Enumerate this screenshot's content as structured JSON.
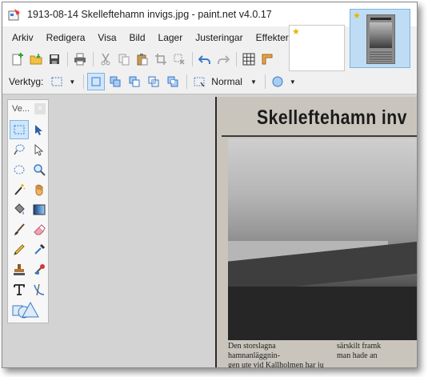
{
  "window": {
    "title": "1913-08-14 Skelleftehamn invigs.jpg - paint.net v4.0.17"
  },
  "menu": [
    "Arkiv",
    "Redigera",
    "Visa",
    "Bild",
    "Lager",
    "Justeringar",
    "Effekter"
  ],
  "toolbar": {
    "buttons": [
      "new-icon",
      "open-icon",
      "save-icon",
      "print-icon",
      "cut-icon",
      "copy-icon",
      "paste-icon",
      "crop-icon",
      "deselect-icon",
      "undo-icon",
      "redo-icon",
      "grid-icon",
      "ruler-icon"
    ]
  },
  "options": {
    "tool_label": "Verktyg:",
    "blend_mode": "Normal"
  },
  "tools_panel": {
    "title": "Ve...",
    "close": "×",
    "tools": [
      "rectangle-select",
      "move-selection",
      "lasso-select",
      "move-selected",
      "ellipse-select",
      "zoom",
      "magic-wand",
      "pan",
      "paint-bucket",
      "gradient",
      "paintbrush",
      "eraser",
      "pencil",
      "color-picker",
      "clone-stamp",
      "recolor",
      "text",
      "line-curve",
      "shapes"
    ]
  },
  "canvas": {
    "headline": "Skelleftehamn inv",
    "text_left": [
      "Den storslagna hamnanläggnin-",
      "gen ute vid Kallholmen har ju"
    ],
    "text_right": [
      "särskilt framk",
      "man hade an"
    ]
  },
  "colors": {
    "accent": "#4a90d9",
    "selected_bg": "#cfe6fb",
    "workspace": "#d3d3d3"
  }
}
